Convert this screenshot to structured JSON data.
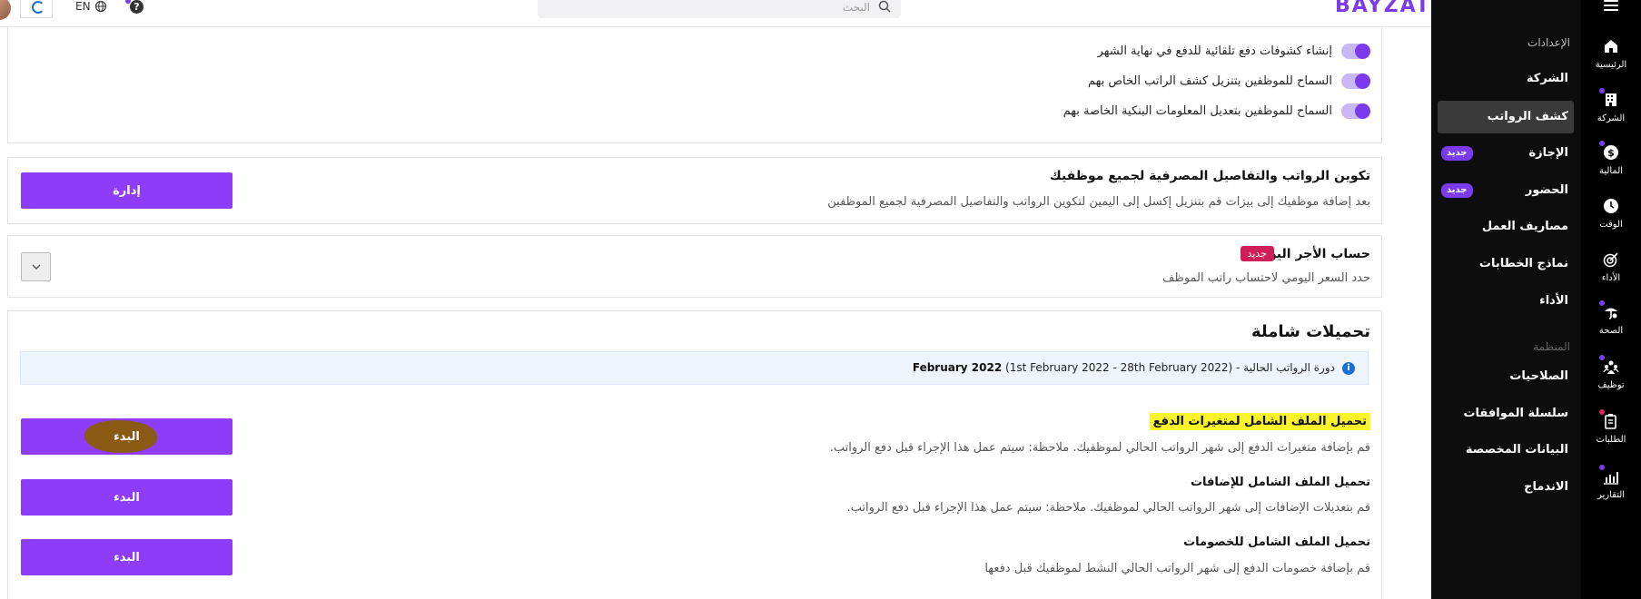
{
  "topbar": {
    "lang": "EN",
    "help": "?",
    "search_placeholder": "البحث",
    "brand": "BAYZAT"
  },
  "settings_toggles": [
    {
      "label": "إنشاء كشوفات دفع تلقائية للدفع في نهاية الشهر",
      "on": true
    },
    {
      "label": "السماح للموظفين بتنزيل كشف الراتب الخاص بهم",
      "on": true
    },
    {
      "label": "السماح للموظفين بتعديل المعلومات البنكية الخاصة بهم",
      "on": true
    }
  ],
  "payroll_config": {
    "title": "تكوين الرواتب والتفاصيل المصرفية لجميع موظفيك",
    "description": "بعد إضافة موظفيك إلى بيزات قم بتنزيل إكسل إلى اليمين لتكوين الرواتب والتفاصيل المصرفية لجميع الموظفين",
    "button": "إدارة"
  },
  "daily_wage": {
    "title": "حساب الأجر اليومي",
    "badge": "جديد",
    "description": "حدد السعر اليومي لاحتساب راتب الموظف"
  },
  "bulk_uploads": {
    "heading": "تحميلات شاملة",
    "cycle_label": "دورة الرواتب الحالية -",
    "cycle_range": "(1st February 2022 - 28th February 2022)",
    "cycle_month": "February 2022",
    "items": [
      {
        "title": "تحميل الملف الشامل لمتغيرات الدفع",
        "description": "قم بإضافة متغيرات الدفع إلى شهر الرواتب الحالي لموظفيك. ملاحظة: سيتم عمل هذا الإجراء قبل دفع الرواتب.",
        "button": "البدء"
      },
      {
        "title": "تحميل الملف الشامل للإضافات",
        "description": "قم بتعديلات الإضافات إلى شهر الرواتب الحالي لموظفيك. ملاحظة: سيتم عمل هذا الإجراء قبل دفع الرواتب.",
        "button": "البدء"
      },
      {
        "title": "تحميل الملف الشامل للخصومات",
        "description": "قم بإضافة خصومات الدفع إلى شهر الرواتب الحالي النشط لموظفيك قبل دفعها",
        "button": "البدء"
      }
    ]
  },
  "subnav": {
    "settings_section": "الإعدادات",
    "items": [
      {
        "label": "الشركة"
      },
      {
        "label": "كشف الرواتب"
      },
      {
        "label": "الإجازة",
        "badge": "جديد"
      },
      {
        "label": "الحضور",
        "badge": "جديد"
      },
      {
        "label": "مصاريف العمل"
      },
      {
        "label": "نماذج الخطابات"
      },
      {
        "label": "الأداء"
      }
    ],
    "org_section": "المنظمة",
    "org_items": [
      {
        "label": "الصلاحيات"
      },
      {
        "label": "سلسلة الموافقات"
      },
      {
        "label": "البيانات المخصصة"
      },
      {
        "label": "الاندماج"
      }
    ]
  },
  "rail": {
    "items": [
      {
        "label": "الرئيسية",
        "icon": "home-icon"
      },
      {
        "label": "الشركة",
        "icon": "building-icon"
      },
      {
        "label": "المالية",
        "icon": "dollar-icon"
      },
      {
        "label": "الوقت",
        "icon": "clock-icon"
      },
      {
        "label": "الأداء",
        "icon": "target-icon"
      },
      {
        "label": "الصحة",
        "icon": "health-icon"
      },
      {
        "label": "توظيف",
        "icon": "people-icon"
      },
      {
        "label": "الطلبات",
        "icon": "clipboard-icon"
      },
      {
        "label": "التقارير",
        "icon": "chart-icon"
      }
    ]
  },
  "colors": {
    "primary": "#8e3cf7",
    "sidebar_bg": "#0d0d0d",
    "badge_new_pink": "#cf1f5a",
    "highlight_yellow": "#fbf32a"
  }
}
